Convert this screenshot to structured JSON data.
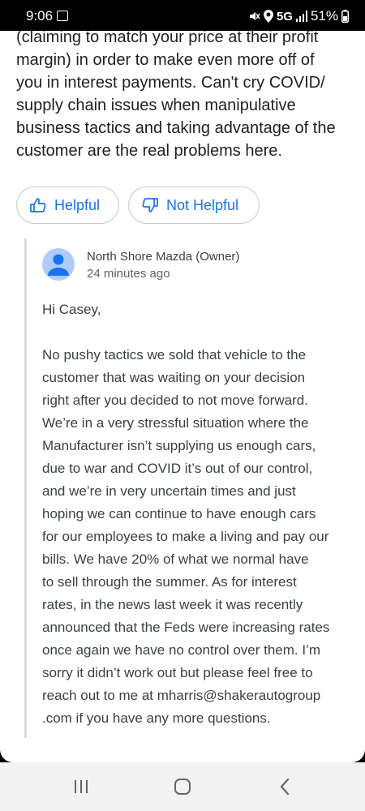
{
  "status_bar": {
    "time": "9:06",
    "network": "5G",
    "battery": "51%"
  },
  "review": {
    "text_lines": [
      "(claiming to match your price at their profit",
      "margin) in order to make even more off of",
      "you in interest payments. Can't cry COVID/",
      "supply chain issues when manipulative",
      "business tactics and taking advantage of the",
      "customer are the real problems here."
    ]
  },
  "votes": {
    "helpful_label": "Helpful",
    "not_helpful_label": "Not Helpful"
  },
  "owner_reply": {
    "name": "North Shore Mazda (Owner)",
    "time": "24 minutes ago",
    "greeting": "Hi Casey,",
    "body_lines": [
      "No pushy tactics we sold that vehicle to the",
      "customer that was waiting on your decision",
      "right after you decided to not move forward.",
      "We’re in a very stressful situation where the",
      "Manufacturer isn’t supplying us enough cars,",
      "due to war and COVID it’s out of our control,",
      "and we’re in very uncertain times and just",
      "hoping we can continue to have enough cars",
      "for our employees to make a living and pay our",
      "bills. We have 20% of what we normal have",
      "to sell through the summer. As for interest",
      "rates, in the news last week it was recently",
      "announced that the Feds were increasing rates",
      "once again we have no control over them. I’m",
      "sorry it didn’t work out but please feel free to",
      "reach out to me at mharris@shakerautogroup",
      ".com if you have any more questions."
    ]
  }
}
